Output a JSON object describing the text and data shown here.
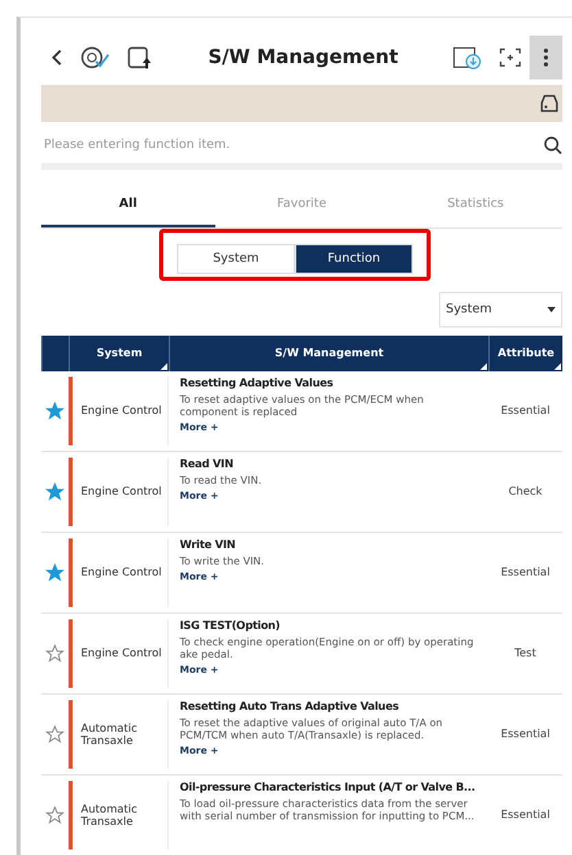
{
  "header": {
    "title": "S/W Management"
  },
  "search": {
    "placeholder": "Please entering function item."
  },
  "tabs": [
    {
      "label": "All",
      "selected": true
    },
    {
      "label": "Favorite",
      "selected": false
    },
    {
      "label": "Statistics",
      "selected": false
    }
  ],
  "segments": [
    {
      "label": "System",
      "selected": false
    },
    {
      "label": "Function",
      "selected": true
    }
  ],
  "filter": {
    "value": "System"
  },
  "table": {
    "columns": [
      "System",
      "S/W Management",
      "Attribute"
    ],
    "rows": [
      {
        "favorite": true,
        "system": "Engine Control",
        "title": "Resetting Adaptive Values",
        "description": "To reset adaptive values on the PCM/ECM when component is replaced",
        "more": "More +",
        "attribute": "Essential"
      },
      {
        "favorite": true,
        "system": "Engine Control",
        "title": "Read VIN",
        "description": "To read the VIN.",
        "more": "More +",
        "attribute": "Check"
      },
      {
        "favorite": true,
        "system": "Engine Control",
        "title": "Write VIN",
        "description": "To write the VIN.",
        "more": "More +",
        "attribute": "Essential"
      },
      {
        "favorite": false,
        "system": "Engine Control",
        "title": "ISG TEST(Option)",
        "description": "To check engine operation(Engine on or off) by operating ake pedal.",
        "more": "More +",
        "attribute": "Test"
      },
      {
        "favorite": false,
        "system": "Automatic Transaxle",
        "title": "Resetting Auto Trans Adaptive Values",
        "description": "To reset the adaptive values of original auto T/A on PCM/TCM when auto T/A(Transaxle) is replaced.",
        "more": "More +",
        "attribute": "Essential"
      },
      {
        "favorite": false,
        "system": "Automatic Transaxle",
        "title": "Oil-pressure Characteristics Input (A/T or Valve B...",
        "description": "To load oil-pressure characteristics data from the server with serial number of transmission for inputting to PCM...",
        "attribute": "Essential"
      }
    ]
  }
}
